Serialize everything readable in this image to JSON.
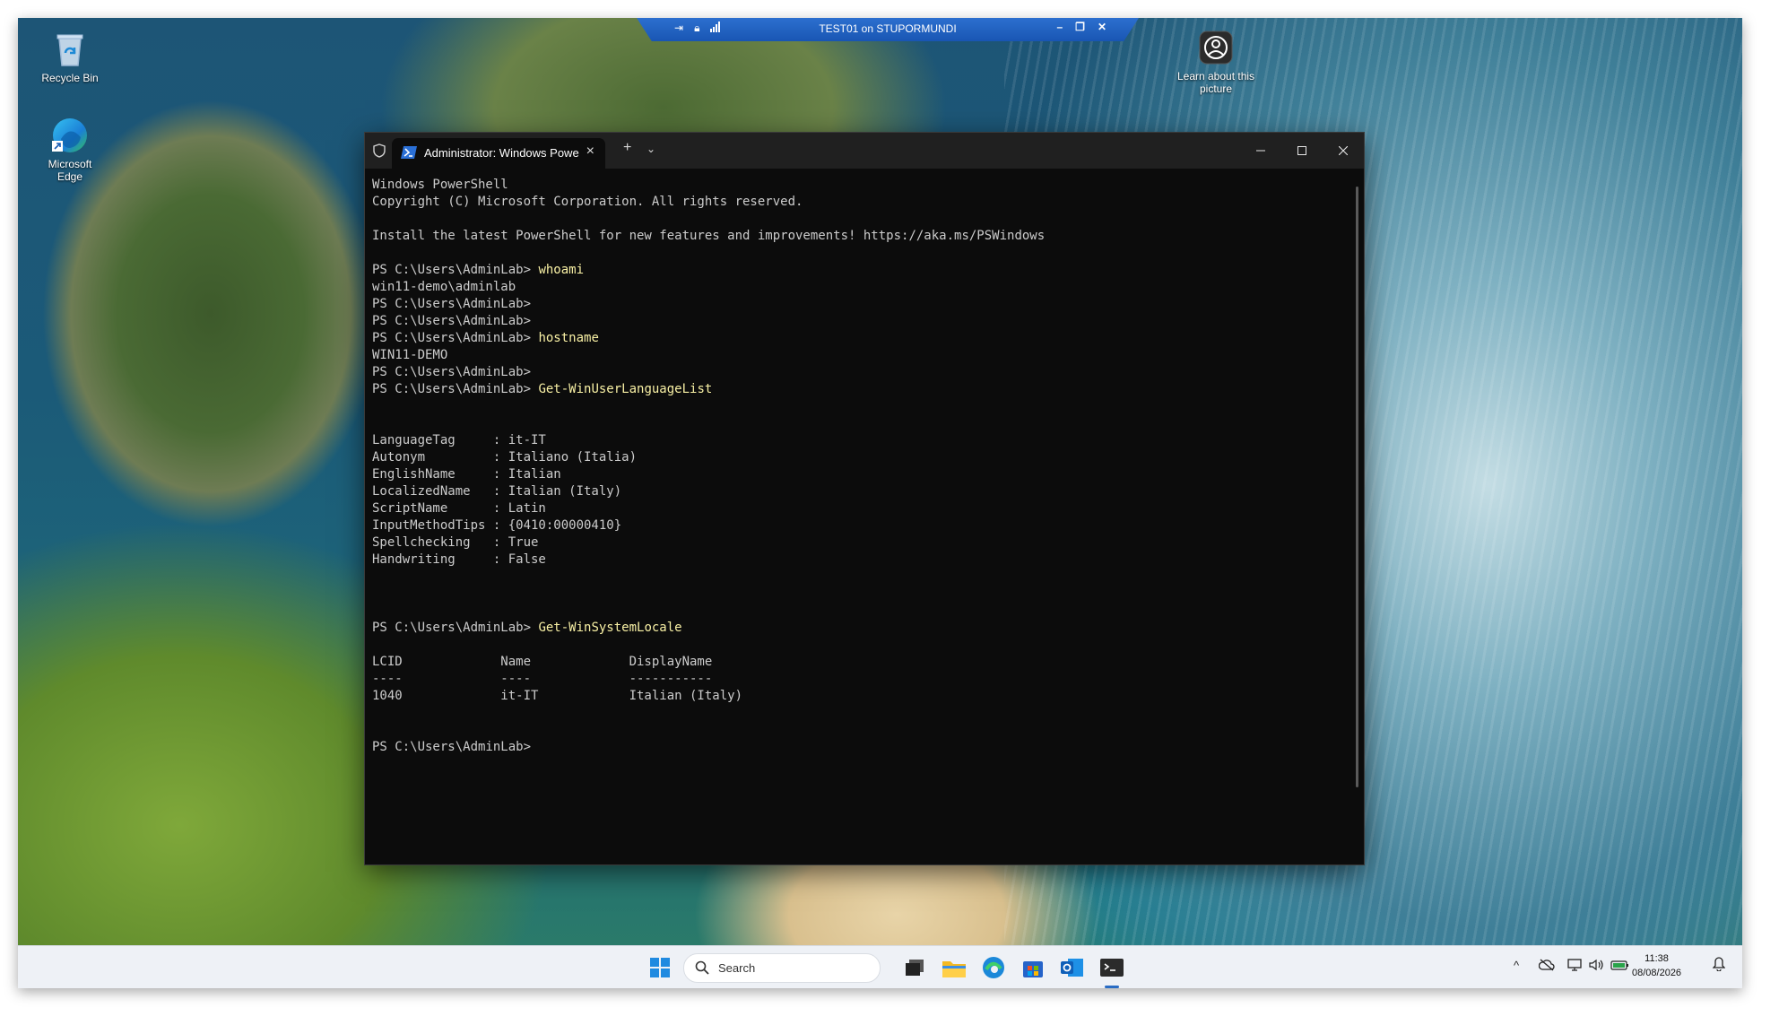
{
  "desktop": {
    "icons": [
      {
        "label": "Recycle Bin",
        "icon": "recycle-bin-icon"
      },
      {
        "label": "Microsoft Edge",
        "icon": "edge-icon"
      },
      {
        "label": "Learn about this picture",
        "icon": "learn-about-picture-icon"
      }
    ]
  },
  "rdp": {
    "title": "TEST01 on STUPORMUNDI"
  },
  "terminal": {
    "tab_label": "Administrator: Windows Powe",
    "lines": [
      {
        "text": "Windows PowerShell"
      },
      {
        "text": "Copyright (C) Microsoft Corporation. All rights reserved."
      },
      {
        "text": ""
      },
      {
        "text": "Install the latest PowerShell for new features and improvements! https://aka.ms/PSWindows"
      },
      {
        "text": ""
      },
      {
        "prompt": "PS C:\\Users\\AdminLab> ",
        "cmd": "whoami"
      },
      {
        "text": "win11-demo\\adminlab"
      },
      {
        "text": "PS C:\\Users\\AdminLab>"
      },
      {
        "text": "PS C:\\Users\\AdminLab>"
      },
      {
        "prompt": "PS C:\\Users\\AdminLab> ",
        "cmd": "hostname"
      },
      {
        "text": "WIN11-DEMO"
      },
      {
        "text": "PS C:\\Users\\AdminLab>"
      },
      {
        "prompt": "PS C:\\Users\\AdminLab> ",
        "cmd": "Get-WinUserLanguageList"
      },
      {
        "text": ""
      },
      {
        "text": ""
      },
      {
        "text": "LanguageTag     : it-IT"
      },
      {
        "text": "Autonym         : Italiano (Italia)"
      },
      {
        "text": "EnglishName     : Italian"
      },
      {
        "text": "LocalizedName   : Italian (Italy)"
      },
      {
        "text": "ScriptName      : Latin"
      },
      {
        "text": "InputMethodTips : {0410:00000410}"
      },
      {
        "text": "Spellchecking   : True"
      },
      {
        "text": "Handwriting     : False"
      },
      {
        "text": ""
      },
      {
        "text": ""
      },
      {
        "text": ""
      },
      {
        "prompt": "PS C:\\Users\\AdminLab> ",
        "cmd": "Get-WinSystemLocale"
      },
      {
        "text": ""
      },
      {
        "text": "LCID             Name             DisplayName"
      },
      {
        "text": "----             ----             -----------"
      },
      {
        "text": "1040             it-IT            Italian (Italy)"
      },
      {
        "text": ""
      },
      {
        "text": ""
      },
      {
        "text": "PS C:\\Users\\AdminLab>"
      }
    ]
  },
  "taskbar": {
    "search_placeholder": "Search",
    "apps": [
      "start-icon",
      "search-icon",
      "task-view-icon",
      "file-explorer-icon",
      "edge-icon",
      "store-icon",
      "outlook-icon",
      "terminal-icon"
    ],
    "clock_time": "11:38",
    "clock_date": "08/08/2026"
  }
}
